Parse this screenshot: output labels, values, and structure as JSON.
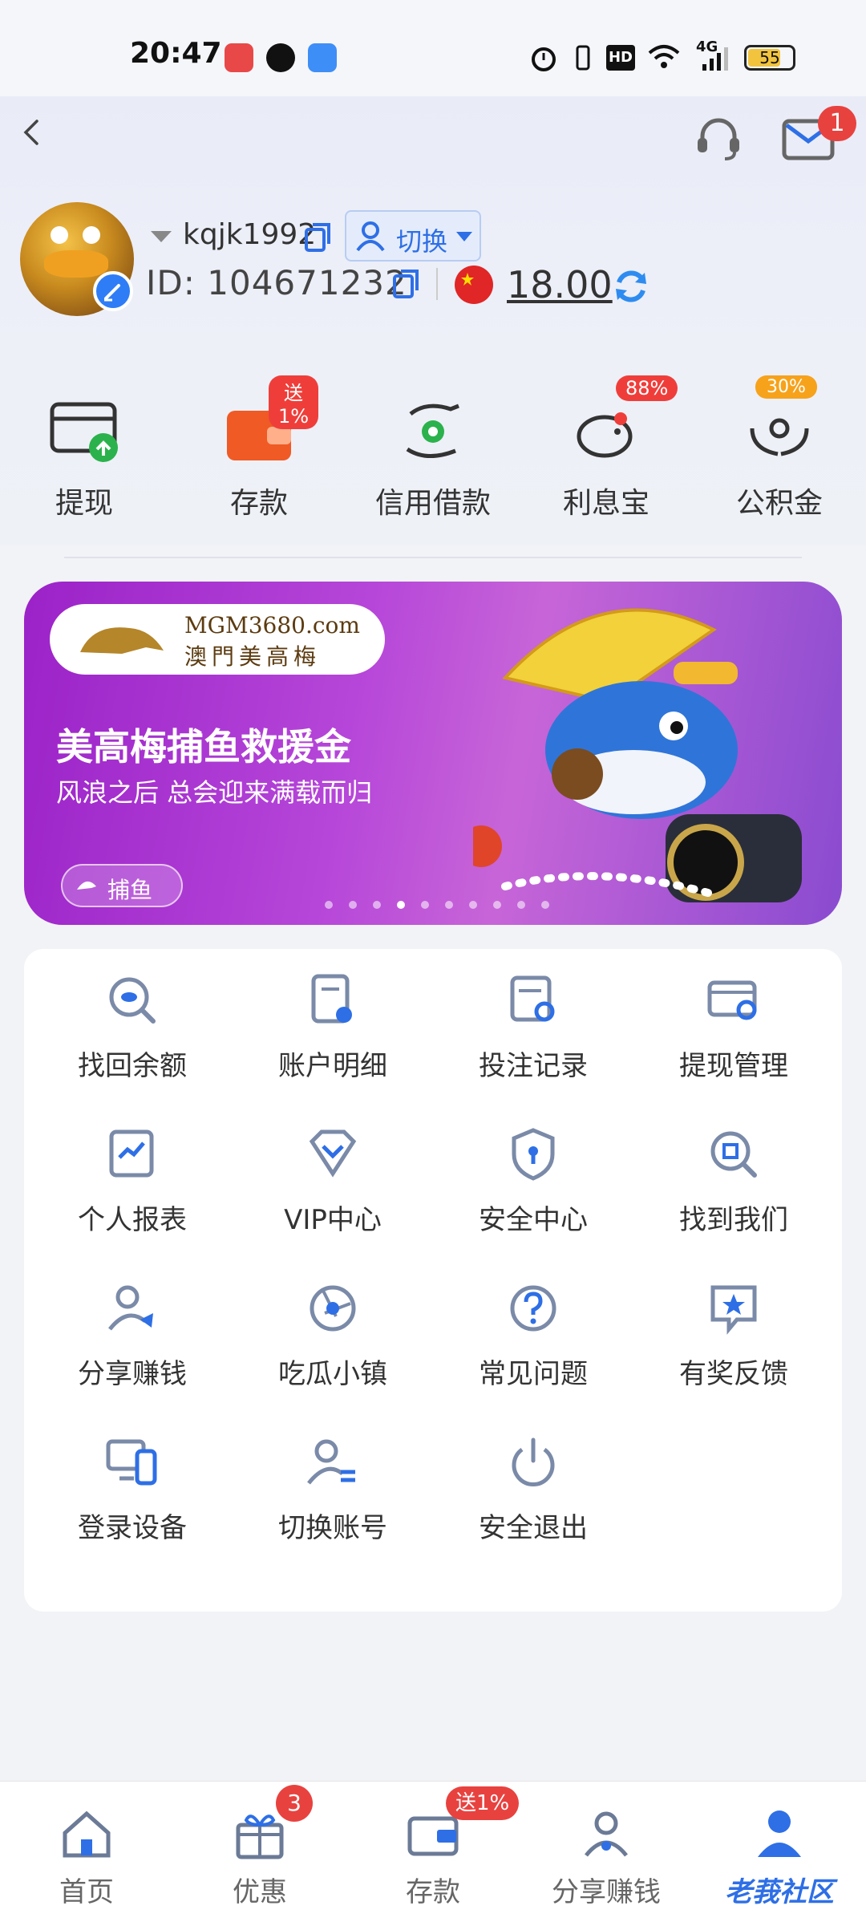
{
  "status_bar": {
    "time": "20:47",
    "battery": "55",
    "network": "4G"
  },
  "header": {
    "mail_badge": "1"
  },
  "profile": {
    "username": "kqjk1992",
    "switch_label": "切换",
    "id_label": "ID:",
    "id_value": "104671232",
    "balance": "18.00"
  },
  "quick_actions": [
    {
      "label": "提现",
      "badge": ""
    },
    {
      "label": "存款",
      "badge": "送1%"
    },
    {
      "label": "信用借款",
      "badge": ""
    },
    {
      "label": "利息宝",
      "badge": "88%"
    },
    {
      "label": "公积金",
      "badge": "30%"
    }
  ],
  "banner": {
    "logo_text": "MGM3680.com",
    "logo_sub": "澳門美高梅",
    "title": "美高梅捕鱼救援金",
    "subtitle": "风浪之后 总会迎来满载而归",
    "button": "捕鱼",
    "page_count": 10,
    "active_page": 3
  },
  "menu": [
    {
      "label": "找回余额",
      "icon": "coin-search-icon"
    },
    {
      "label": "账户明细",
      "icon": "document-icon"
    },
    {
      "label": "投注记录",
      "icon": "record-search-icon"
    },
    {
      "label": "提现管理",
      "icon": "card-settings-icon"
    },
    {
      "label": "个人报表",
      "icon": "chart-icon"
    },
    {
      "label": "VIP中心",
      "icon": "diamond-icon"
    },
    {
      "label": "安全中心",
      "icon": "shield-icon"
    },
    {
      "label": "找到我们",
      "icon": "search-building-icon"
    },
    {
      "label": "分享赚钱",
      "icon": "user-share-icon"
    },
    {
      "label": "吃瓜小镇",
      "icon": "camera-aperture-icon"
    },
    {
      "label": "常见问题",
      "icon": "question-icon"
    },
    {
      "label": "有奖反馈",
      "icon": "star-message-icon"
    },
    {
      "label": "登录设备",
      "icon": "devices-icon"
    },
    {
      "label": "切换账号",
      "icon": "user-switch-icon"
    },
    {
      "label": "安全退出",
      "icon": "power-icon"
    }
  ],
  "bottom_nav": [
    {
      "label": "首页",
      "badge": ""
    },
    {
      "label": "优惠",
      "badge": "3"
    },
    {
      "label": "存款",
      "badge": "送1%"
    },
    {
      "label": "分享赚钱",
      "badge": ""
    },
    {
      "label": "老莪社区",
      "badge": ""
    }
  ],
  "colors": {
    "accent": "#2e6fe6",
    "badge_red": "#e8423f",
    "badge_orange": "#f7a21b",
    "banner_purple": "#9b22c8"
  }
}
